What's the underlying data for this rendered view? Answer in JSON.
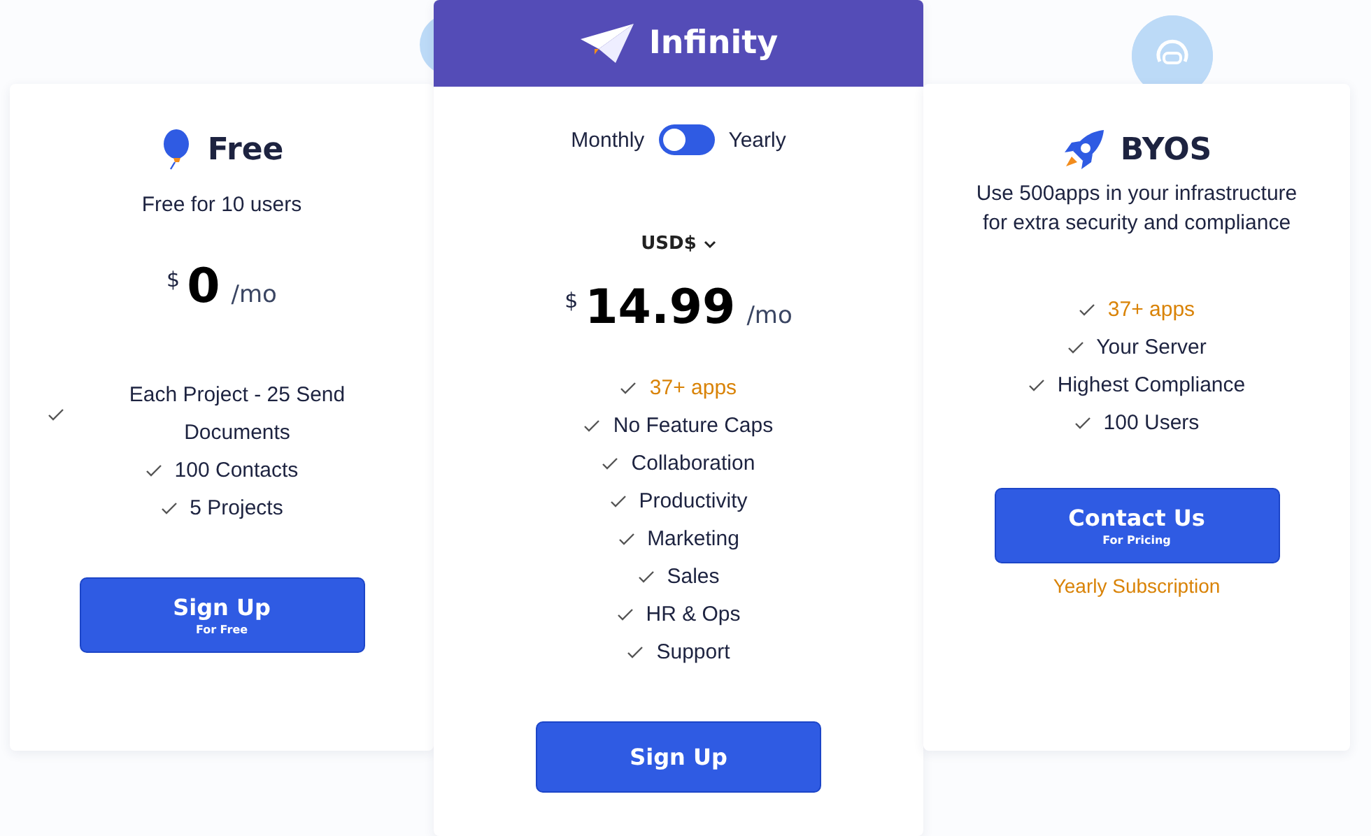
{
  "plans": [
    {
      "name": "Free",
      "featured": false,
      "subtitle": "Free for 10 users",
      "currency_symbol": "$",
      "price": "0",
      "period": "/mo",
      "features": [
        {
          "text": "Each Project - 25 Send Documents",
          "highlight": false
        },
        {
          "text": "100 Contacts",
          "highlight": false
        },
        {
          "text": "5 Projects",
          "highlight": false
        }
      ],
      "button": {
        "label": "Sign Up",
        "sublabel": "For Free"
      }
    },
    {
      "name": "Infinity",
      "featured": true,
      "billing_toggle": {
        "left_label": "Monthly",
        "right_label": "Yearly",
        "on": false
      },
      "currency_selector": "USD$",
      "currency_symbol": "$",
      "price": "14.99",
      "period": "/mo",
      "features": [
        {
          "text": "37+ apps",
          "highlight": true
        },
        {
          "text": "No Feature Caps",
          "highlight": false
        },
        {
          "text": "Collaboration",
          "highlight": false
        },
        {
          "text": "Productivity",
          "highlight": false
        },
        {
          "text": "Marketing",
          "highlight": false
        },
        {
          "text": "Sales",
          "highlight": false
        },
        {
          "text": "HR & Ops",
          "highlight": false
        },
        {
          "text": "Support",
          "highlight": false
        }
      ],
      "button": {
        "label": "Sign Up"
      }
    },
    {
      "name": "BYOS",
      "featured": false,
      "description": "Use 500apps in your infrastructure for extra security and compliance",
      "features": [
        {
          "text": "37+ apps",
          "highlight": true
        },
        {
          "text": "Your Server",
          "highlight": false
        },
        {
          "text": "Highest Compliance",
          "highlight": false
        },
        {
          "text": "100 Users",
          "highlight": false
        }
      ],
      "button": {
        "label": "Contact Us",
        "sublabel": "For Pricing"
      },
      "note": "Yearly Subscription"
    }
  ]
}
